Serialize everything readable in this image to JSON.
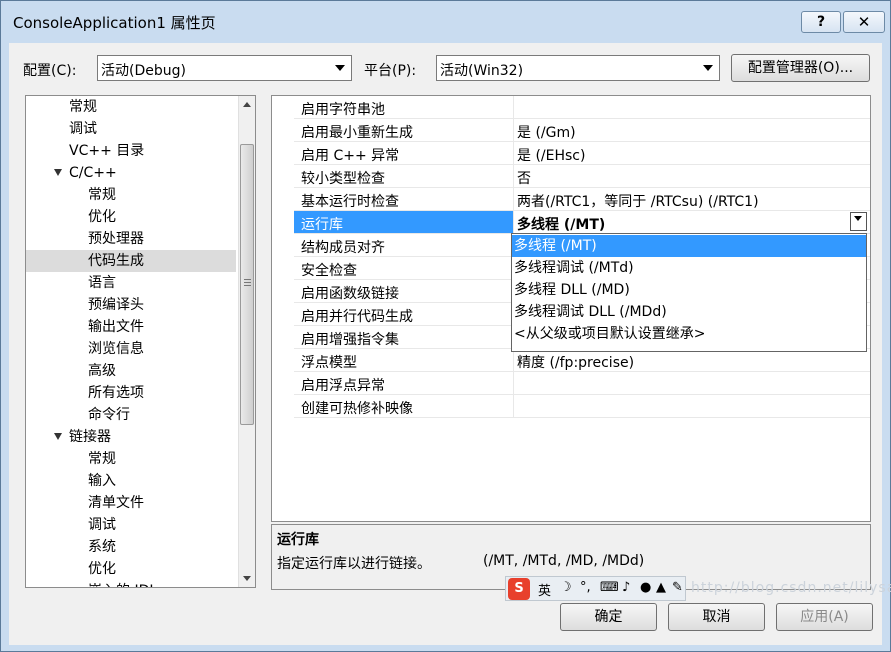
{
  "window": {
    "title": "ConsoleApplication1 属性页",
    "help_glyph": "?",
    "close_glyph": "✕"
  },
  "config_bar": {
    "config_label": "配置(C):",
    "config_value": "活动(Debug)",
    "platform_label": "平台(P):",
    "platform_value": "活动(Win32)",
    "manager_button": "配置管理器(O)..."
  },
  "tree": {
    "items": [
      {
        "label": "常规",
        "level": 1
      },
      {
        "label": "调试",
        "level": 1
      },
      {
        "label": "VC++ 目录",
        "level": 1
      },
      {
        "label": "C/C++",
        "level": 1,
        "expanded": true
      },
      {
        "label": "常规",
        "level": 2
      },
      {
        "label": "优化",
        "level": 2
      },
      {
        "label": "预处理器",
        "level": 2
      },
      {
        "label": "代码生成",
        "level": 2,
        "selected": true
      },
      {
        "label": "语言",
        "level": 2
      },
      {
        "label": "预编译头",
        "level": 2
      },
      {
        "label": "输出文件",
        "level": 2
      },
      {
        "label": "浏览信息",
        "level": 2
      },
      {
        "label": "高级",
        "level": 2
      },
      {
        "label": "所有选项",
        "level": 2
      },
      {
        "label": "命令行",
        "level": 2
      },
      {
        "label": "链接器",
        "level": 1,
        "expanded": true
      },
      {
        "label": "常规",
        "level": 2
      },
      {
        "label": "输入",
        "level": 2
      },
      {
        "label": "清单文件",
        "level": 2
      },
      {
        "label": "调试",
        "level": 2
      },
      {
        "label": "系统",
        "level": 2
      },
      {
        "label": "优化",
        "level": 2
      },
      {
        "label": "嵌入的 IDL",
        "level": 2
      }
    ]
  },
  "grid": {
    "rows": [
      {
        "name": "启用字符串池",
        "value": ""
      },
      {
        "name": "启用最小重新生成",
        "value": "是 (/Gm)"
      },
      {
        "name": "启用 C++ 异常",
        "value": "是 (/EHsc)"
      },
      {
        "name": "较小类型检查",
        "value": "否"
      },
      {
        "name": "基本运行时检查",
        "value": "两者(/RTC1，等同于 /RTCsu) (/RTC1)"
      },
      {
        "name": "运行库",
        "value": "多线程 (/MT)",
        "selected": true
      },
      {
        "name": "结构成员对齐",
        "value": ""
      },
      {
        "name": "安全检查",
        "value": ""
      },
      {
        "name": "启用函数级链接",
        "value": ""
      },
      {
        "name": "启用并行代码生成",
        "value": ""
      },
      {
        "name": "启用增强指令集",
        "value": ""
      },
      {
        "name": "浮点模型",
        "value": "精度 (/fp:precise)"
      },
      {
        "name": "启用浮点异常",
        "value": ""
      },
      {
        "name": "创建可热修补映像",
        "value": ""
      }
    ],
    "dropdown_options": [
      {
        "label": "多线程 (/MT)",
        "highlighted": true
      },
      {
        "label": "多线程调试 (/MTd)"
      },
      {
        "label": "多线程 DLL (/MD)"
      },
      {
        "label": "多线程调试 DLL (/MDd)"
      },
      {
        "label": "<从父级或项目默认设置继承>"
      }
    ]
  },
  "description": {
    "title": "运行库",
    "text": "指定运行库以进行链接。",
    "switches": "(/MT, /MTd, /MD, /MDd)"
  },
  "buttons": {
    "ok": "确定",
    "cancel": "取消",
    "apply": "应用(A)"
  },
  "ime_toolbar": {
    "logo": "S",
    "lang": "英"
  },
  "watermark": "http://blog.csdn.net/lilysara"
}
